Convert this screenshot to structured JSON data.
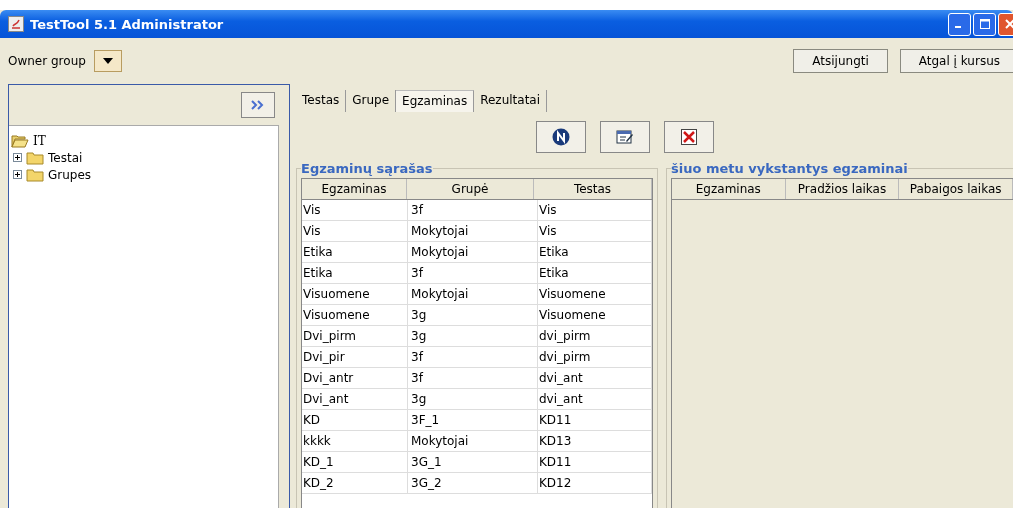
{
  "window": {
    "title": "TestTool 5.1 Administrator"
  },
  "toolbar": {
    "owner_group_label": "Owner group",
    "buttons": [
      "Atsijungti",
      "Atgal į kursus"
    ]
  },
  "tree": {
    "items": [
      {
        "label": "IT",
        "expanded": true,
        "children": [
          {
            "label": "Testai",
            "expanded": false
          },
          {
            "label": "Grupes",
            "expanded": false
          }
        ]
      }
    ]
  },
  "tabs": [
    {
      "label": "Testas",
      "selected": false
    },
    {
      "label": "Grupe",
      "selected": false
    },
    {
      "label": "Egzaminas",
      "selected": true
    },
    {
      "label": "Rezultatai",
      "selected": false
    }
  ],
  "actions": [
    {
      "kind": "new"
    },
    {
      "kind": "edit"
    },
    {
      "kind": "delete"
    }
  ],
  "exams": {
    "title": "Egzaminų sąrašas",
    "columns": [
      "Egzaminas",
      "Grupė",
      "Testas"
    ],
    "rows": [
      [
        "Vis",
        "3f",
        "Vis"
      ],
      [
        "Vis",
        "Mokytojai",
        "Vis"
      ],
      [
        "Etika",
        "Mokytojai",
        "Etika"
      ],
      [
        "Etika",
        "3f",
        "Etika"
      ],
      [
        "Visuomene",
        "Mokytojai",
        "Visuomene"
      ],
      [
        "Visuomene",
        "3g",
        "Visuomene"
      ],
      [
        "Dvi_pirm",
        "3g",
        "dvi_pirm"
      ],
      [
        "Dvi_pir",
        "3f",
        "dvi_pirm"
      ],
      [
        "Dvi_antr",
        "3f",
        "dvi_ant"
      ],
      [
        "Dvi_ant",
        "3g",
        "dvi_ant"
      ],
      [
        "KD",
        "3F_1",
        "KD11"
      ],
      [
        "kkkk",
        "Mokytojai",
        "KD13"
      ],
      [
        "KD_1",
        "3G_1",
        "KD11"
      ],
      [
        "KD_2",
        "3G_2",
        "KD12"
      ]
    ]
  },
  "running": {
    "title": "šiuo metu vykstantys egzaminai",
    "columns": [
      "Egzaminas",
      "Pradžios laikas",
      "Pabaigos laikas"
    ]
  }
}
